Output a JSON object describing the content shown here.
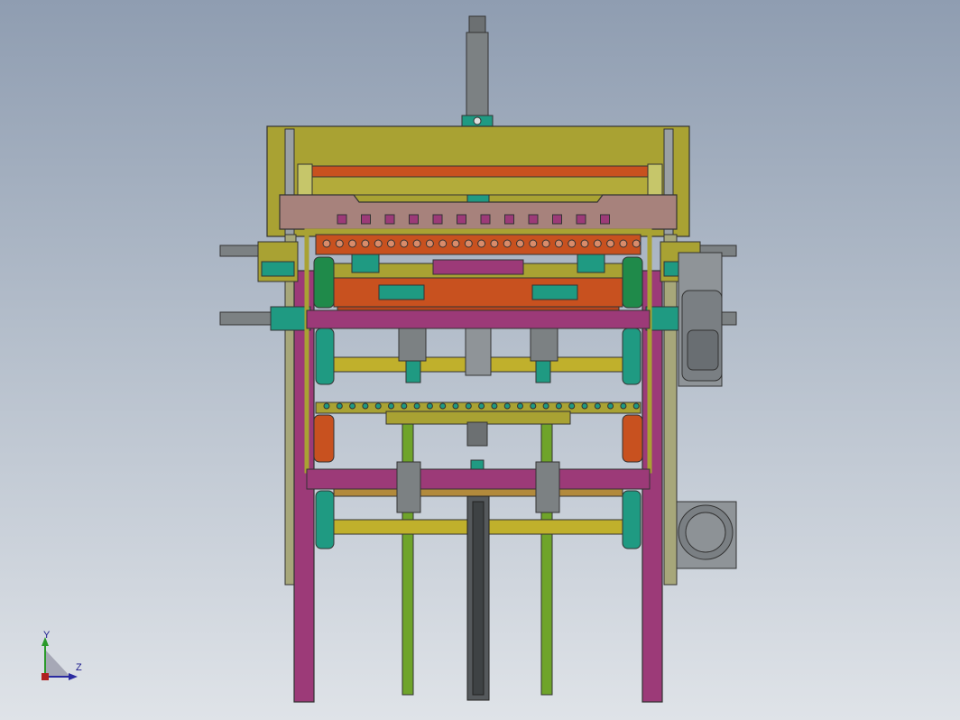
{
  "viewport": {
    "background_top": "#8f9db1",
    "background_bottom": "#dfe3e8"
  },
  "colors": {
    "frame_purple": "#9c3a78",
    "frame_olive": "#a9a233",
    "beam_pink": "#a7827c",
    "roller_orange": "#c8511f",
    "teal": "#1f9a82",
    "shaft_yellow": "#c0b02c",
    "rod_green": "#6fa42a",
    "motor_gray": "#8f9498",
    "cylinder_gray": "#6c7072"
  },
  "triad": {
    "y_label": "Y",
    "z_label": "Z",
    "x_icon": "axis-origin-icon"
  }
}
